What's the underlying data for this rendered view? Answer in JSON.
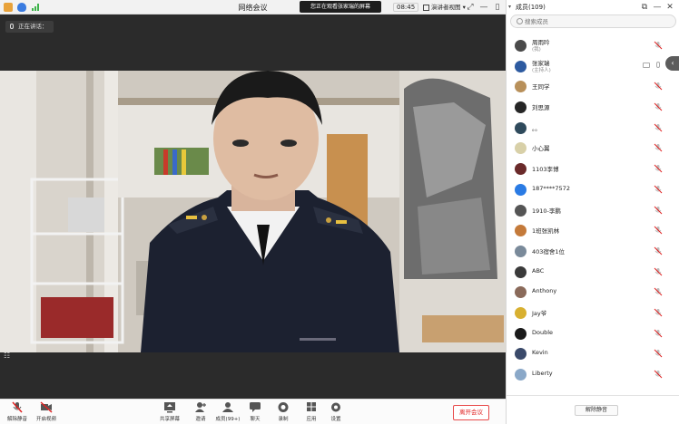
{
  "title_bar": {
    "title": "网络会议",
    "banner_text": "您正在观看张家瑞的屏幕",
    "clock": "08:45",
    "view_mode": "演讲者视图"
  },
  "stage": {
    "speaker_label": "正在讲话："
  },
  "toolbar": {
    "items": [
      {
        "label": "解除静音",
        "icon": "mic-muted-icon"
      },
      {
        "label": "开启视频",
        "icon": "camera-off-icon"
      },
      {
        "label": "共享屏幕",
        "icon": "share-screen-icon"
      },
      {
        "label": "邀请",
        "icon": "invite-icon"
      },
      {
        "label": "成员(99+)",
        "icon": "members-icon"
      },
      {
        "label": "聊天",
        "icon": "chat-icon"
      },
      {
        "label": "录制",
        "icon": "record-icon"
      },
      {
        "label": "应用",
        "icon": "apps-icon"
      },
      {
        "label": "设置",
        "icon": "settings-icon"
      }
    ],
    "leave_label": "离开会议"
  },
  "panel": {
    "title": "成员(109)",
    "search_placeholder": "搜索成员",
    "mute_all_label": "解除静音",
    "members": [
      {
        "name": "周雨吟",
        "sub": "(我)",
        "avatar_color": "#4a4a4a"
      },
      {
        "name": "张家瑞",
        "sub": "(主持人)",
        "avatar_color": "#2d5aa0",
        "host": true
      },
      {
        "name": "王同学",
        "sub": "",
        "avatar_color": "#b8905a"
      },
      {
        "name": "刘思源",
        "sub": "",
        "avatar_color": "#262626"
      },
      {
        "name": "。。",
        "sub": "",
        "avatar_color": "#2f4a5c"
      },
      {
        "name": "小心翼",
        "sub": "",
        "avatar_color": "#d8d0a8"
      },
      {
        "name": "1103李博",
        "sub": "",
        "avatar_color": "#6a2a2a"
      },
      {
        "name": "187****7572",
        "sub": "",
        "avatar_color": "#2a7be4"
      },
      {
        "name": "1910-李鹏",
        "sub": "",
        "avatar_color": "#555555"
      },
      {
        "name": "1班张凯林",
        "sub": "",
        "avatar_color": "#c47a3a"
      },
      {
        "name": "403宿舍1位",
        "sub": "",
        "avatar_color": "#7a8a9a"
      },
      {
        "name": "ABC",
        "sub": "",
        "avatar_color": "#3a3a3a"
      },
      {
        "name": "Anthony",
        "sub": "",
        "avatar_color": "#8a6a5a"
      },
      {
        "name": "Jay爷",
        "sub": "",
        "avatar_color": "#d8b030"
      },
      {
        "name": "Double",
        "sub": "",
        "avatar_color": "#1a1a1a"
      },
      {
        "name": "Kevin",
        "sub": "",
        "avatar_color": "#3a4a6a"
      },
      {
        "name": "Liberty",
        "sub": "",
        "avatar_color": "#8aa8c8"
      }
    ]
  },
  "colors": {
    "accent_red": "#e02020",
    "panel_bg": "#ffffff",
    "stage_bg": "#2b2b2b"
  }
}
